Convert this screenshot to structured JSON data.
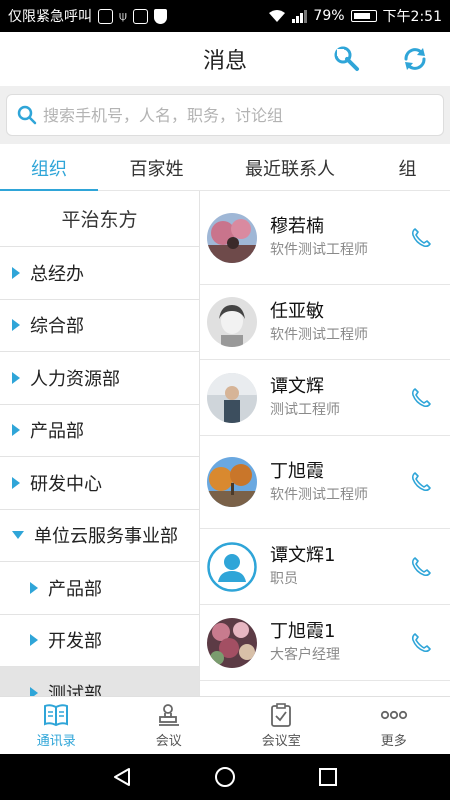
{
  "status_bar": {
    "carrier": "仅限紧急呼叫",
    "battery": "79%",
    "time": "下午2:51"
  },
  "header": {
    "title": "消息",
    "settings_icon": "wrench-icon",
    "refresh_icon": "refresh-icon"
  },
  "search": {
    "placeholder": "搜索手机号，人名，职务，讨论组",
    "value": ""
  },
  "tabs": [
    {
      "label": "组织",
      "active": true
    },
    {
      "label": "百家姓",
      "active": false
    },
    {
      "label": "最近联系人",
      "active": false
    },
    {
      "label": "组",
      "active": false
    }
  ],
  "org": {
    "title": "平治东方",
    "departments": [
      {
        "label": "总经办",
        "level": 0,
        "expanded": false
      },
      {
        "label": "综合部",
        "level": 0,
        "expanded": false
      },
      {
        "label": "人力资源部",
        "level": 0,
        "expanded": false
      },
      {
        "label": "产品部",
        "level": 0,
        "expanded": false
      },
      {
        "label": "研发中心",
        "level": 0,
        "expanded": false
      },
      {
        "label": "单位云服务事业部",
        "level": 0,
        "expanded": true
      },
      {
        "label": "产品部",
        "level": 1,
        "expanded": false
      },
      {
        "label": "开发部",
        "level": 1,
        "expanded": false
      },
      {
        "label": "测试部",
        "level": 1,
        "expanded": false,
        "selected": true
      }
    ]
  },
  "contacts": [
    {
      "name": "穆若楠",
      "role": "软件测试工程师",
      "has_phone": true
    },
    {
      "name": "任亚敏",
      "role": "软件测试工程师",
      "has_phone": false
    },
    {
      "name": "谭文辉",
      "role": "测试工程师",
      "has_phone": true
    },
    {
      "name": "丁旭霞",
      "role": "软件测试工程师",
      "has_phone": true
    },
    {
      "name": "谭文辉1",
      "role": "职员",
      "has_phone": true
    },
    {
      "name": "丁旭霞1",
      "role": "大客户经理",
      "has_phone": true
    }
  ],
  "bottom_nav": [
    {
      "label": "通讯录",
      "icon": "book-icon",
      "active": true
    },
    {
      "label": "会议",
      "icon": "stamp-icon",
      "active": false
    },
    {
      "label": "会议室",
      "icon": "clipboard-check-icon",
      "active": false
    },
    {
      "label": "更多",
      "icon": "more-dots-icon",
      "active": false
    }
  ],
  "colors": {
    "accent": "#2fa5d8"
  }
}
